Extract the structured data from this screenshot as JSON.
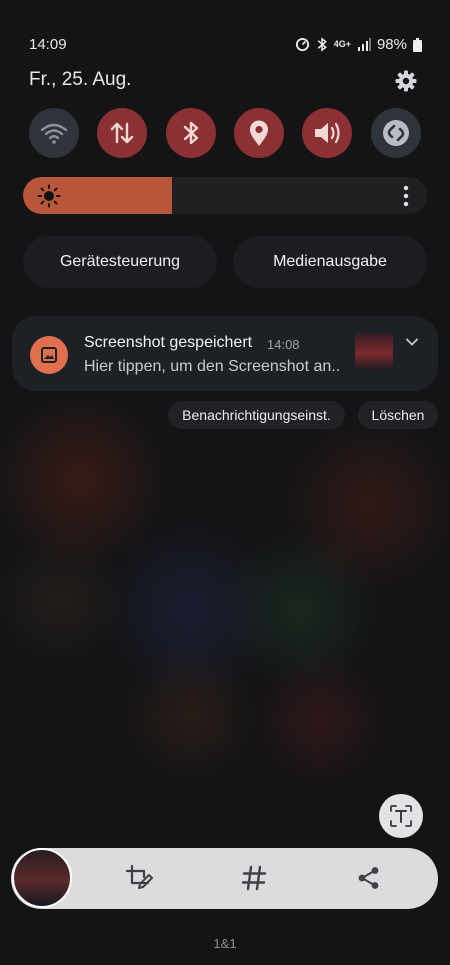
{
  "status_bar": {
    "time": "14:09",
    "battery": "98%",
    "network": "4G+"
  },
  "header": {
    "date": "Fr., 25. Aug."
  },
  "quick_settings": [
    {
      "name": "wifi",
      "state": "off"
    },
    {
      "name": "mobile-data",
      "state": "on"
    },
    {
      "name": "bluetooth",
      "state": "on"
    },
    {
      "name": "location",
      "state": "on"
    },
    {
      "name": "sound",
      "state": "on"
    },
    {
      "name": "shazam",
      "state": "off"
    }
  ],
  "brightness": {
    "level": 0.37
  },
  "buttons": {
    "device_control": "Gerätesteuerung",
    "media_output": "Medienausgabe"
  },
  "notification": {
    "title": "Screenshot gespeichert",
    "time": "14:08",
    "body": "Hier tippen, um den Screenshot an.."
  },
  "notification_actions": {
    "settings": "Benachrichtigungseinst.",
    "clear": "Löschen"
  },
  "carrier": "1&1",
  "colors": {
    "accent": "#b8573a",
    "toggle_on": "#8c3133",
    "toggle_off": "#2f333a",
    "notif_icon": "#e06f4e"
  }
}
